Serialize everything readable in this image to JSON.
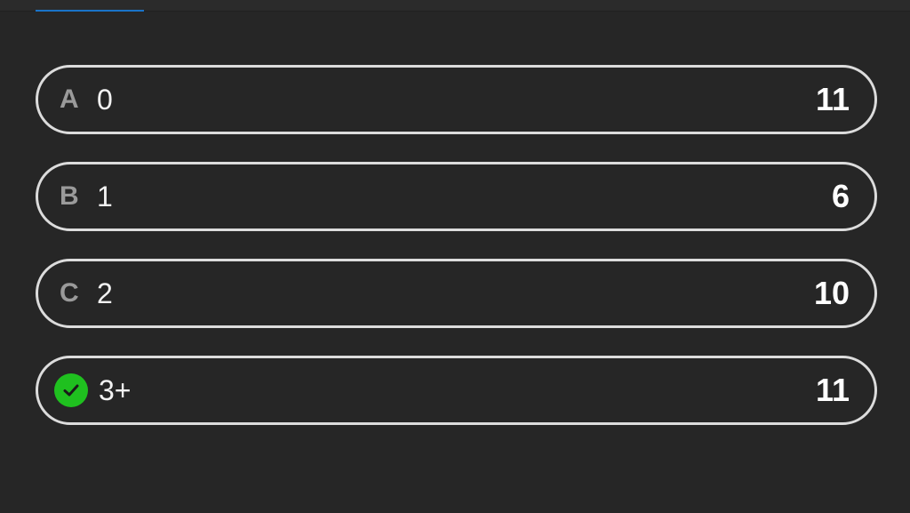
{
  "colors": {
    "background": "#262626",
    "border": "#dcdcdc",
    "correct": "#1fc01f",
    "tab_indicator": "#1a73c8"
  },
  "options": [
    {
      "letter": "A",
      "label": "0",
      "count": "11",
      "correct": false
    },
    {
      "letter": "B",
      "label": "1",
      "count": "6",
      "correct": false
    },
    {
      "letter": "C",
      "label": "2",
      "count": "10",
      "correct": false
    },
    {
      "letter": "",
      "label": "3+",
      "count": "11",
      "correct": true,
      "icon": "check-circle-icon"
    }
  ]
}
